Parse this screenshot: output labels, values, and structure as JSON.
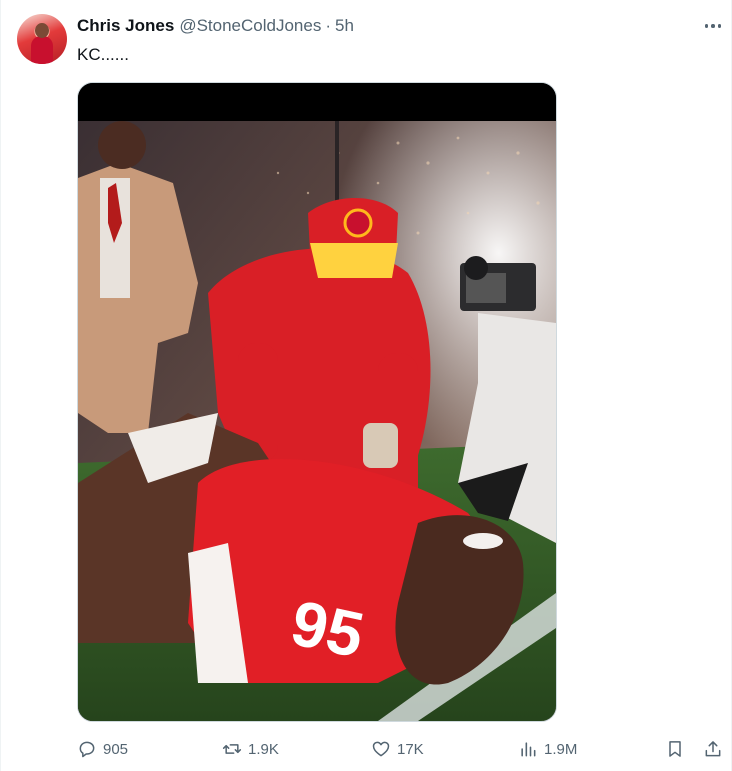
{
  "author": {
    "name": "Chris Jones",
    "handle": "@StoneColdJones",
    "separator": "·",
    "time": "5h"
  },
  "tweet": {
    "text": "KC......"
  },
  "media": {
    "jersey_number": "95"
  },
  "actions": {
    "replies": "905",
    "retweets": "1.9K",
    "likes": "17K",
    "views": "1.9M"
  },
  "icons": {
    "reply": "reply-icon",
    "retweet": "retweet-icon",
    "like": "heart-icon",
    "views": "views-icon",
    "bookmark": "bookmark-icon",
    "share": "share-icon",
    "more": "more-icon"
  },
  "colors": {
    "text_primary": "#0f1419",
    "text_secondary": "#536471",
    "chiefs_red": "#c8102e",
    "chiefs_gold": "#ffb81c"
  }
}
